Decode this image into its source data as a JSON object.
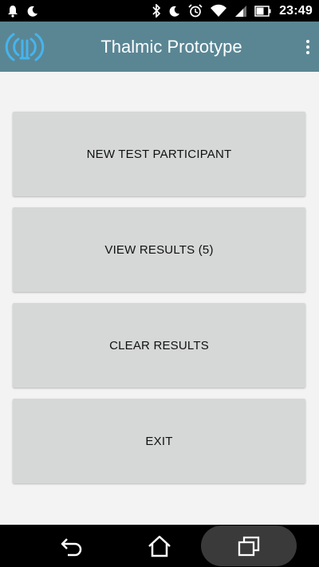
{
  "status_bar": {
    "time": "23:49",
    "icons": [
      "notification-bell-icon",
      "moon-icon",
      "bluetooth-icon",
      "do-not-disturb-moon-icon",
      "alarm-clock-icon",
      "wifi-icon",
      "cellular-signal-icon",
      "battery-icon"
    ]
  },
  "app_bar": {
    "title": "Thalmic Prototype",
    "logo_icon": "myo-armband-logo-icon",
    "menu_icon": "overflow-menu-icon"
  },
  "buttons": {
    "new_participant": "NEW TEST PARTICIPANT",
    "view_results": "VIEW RESULTS (5)",
    "clear_results": "CLEAR RESULTS",
    "exit": "EXIT"
  },
  "nav_bar": {
    "icons": [
      "back-icon",
      "home-icon",
      "recents-icon"
    ]
  },
  "colors": {
    "app_bar": "#5a8694",
    "button": "#d6d7d7",
    "background": "#f3f3f3"
  }
}
